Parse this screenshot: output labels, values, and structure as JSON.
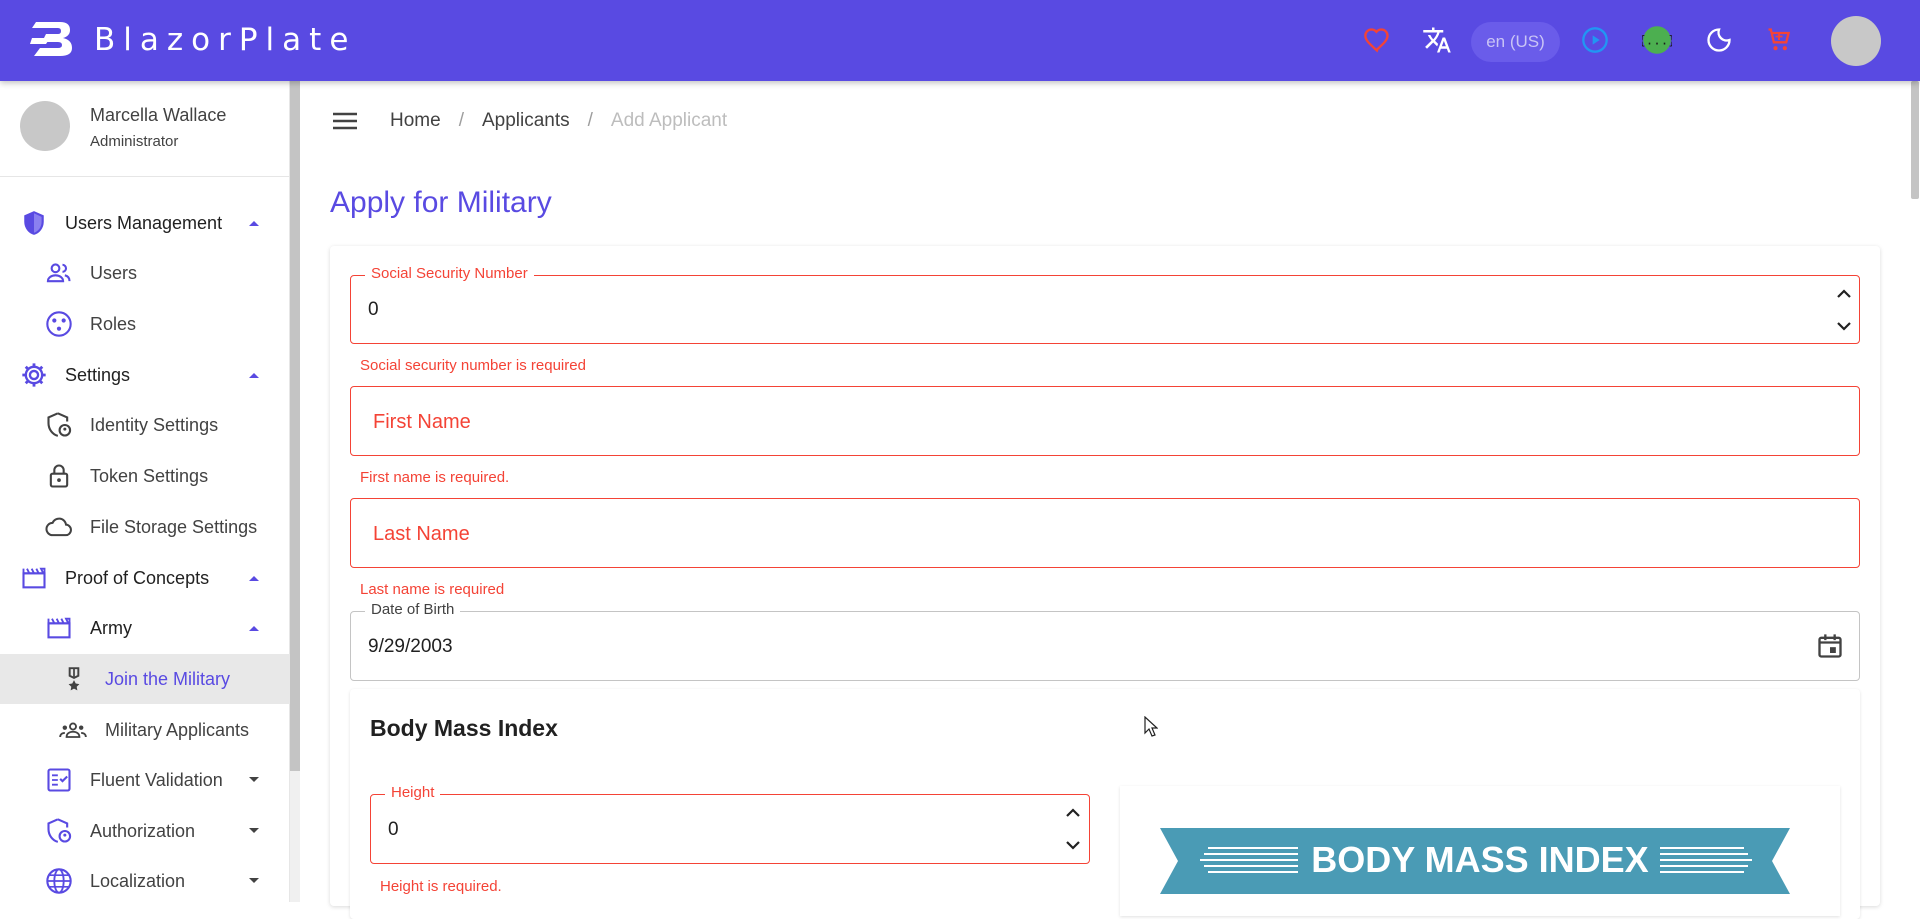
{
  "app": {
    "brand": "BlazorPlate",
    "language": "en (US)",
    "colors": {
      "primary": "#594ae2",
      "error": "#f44336",
      "heart": "#f44336",
      "play": "#2196f3",
      "api": "#4caf50"
    },
    "icons": [
      "heart-icon",
      "translate-icon",
      "play-circle-icon",
      "api-icon",
      "dark-mode-icon",
      "cart-icon"
    ]
  },
  "profile": {
    "name": "Marcella Wallace",
    "role": "Administrator"
  },
  "sidebar": {
    "items": [
      {
        "label": "Users Management",
        "icon": "shield-icon",
        "group": true
      },
      {
        "label": "Users",
        "icon": "people-icon"
      },
      {
        "label": "Roles",
        "icon": "roles-icon"
      },
      {
        "label": "Settings",
        "icon": "gear-icon",
        "group": true
      },
      {
        "label": "Identity Settings",
        "icon": "identity-icon"
      },
      {
        "label": "Token Settings",
        "icon": "lock-icon"
      },
      {
        "label": "File Storage Settings",
        "icon": "cloud-icon"
      },
      {
        "label": "Proof of Concepts",
        "icon": "clapper-icon",
        "group": true
      },
      {
        "label": "Army",
        "icon": "clapper-icon",
        "group": true
      },
      {
        "label": "Join the Military",
        "icon": "medal-icon",
        "active": true
      },
      {
        "label": "Military Applicants",
        "icon": "groups-icon"
      },
      {
        "label": "Fluent Validation",
        "icon": "checklist-icon"
      },
      {
        "label": "Authorization",
        "icon": "policy-icon"
      },
      {
        "label": "Localization",
        "icon": "globe-icon"
      }
    ]
  },
  "breadcrumb": {
    "home": "Home",
    "applicants": "Applicants",
    "current": "Add Applicant",
    "separator": "/"
  },
  "page": {
    "title": "Apply for Military"
  },
  "form": {
    "ssn": {
      "label": "Social Security Number",
      "value": "0",
      "error": "Social security number is required"
    },
    "first_name": {
      "label": "First Name",
      "error": "First name is required."
    },
    "last_name": {
      "label": "Last Name",
      "error": "Last name is required"
    },
    "dob": {
      "label": "Date of Birth",
      "value": "9/29/2003"
    },
    "bmi": {
      "title": "Body Mass Index",
      "height": {
        "label": "Height",
        "value": "0",
        "error": "Height is required."
      },
      "banner": "BODY MASS INDEX"
    }
  }
}
